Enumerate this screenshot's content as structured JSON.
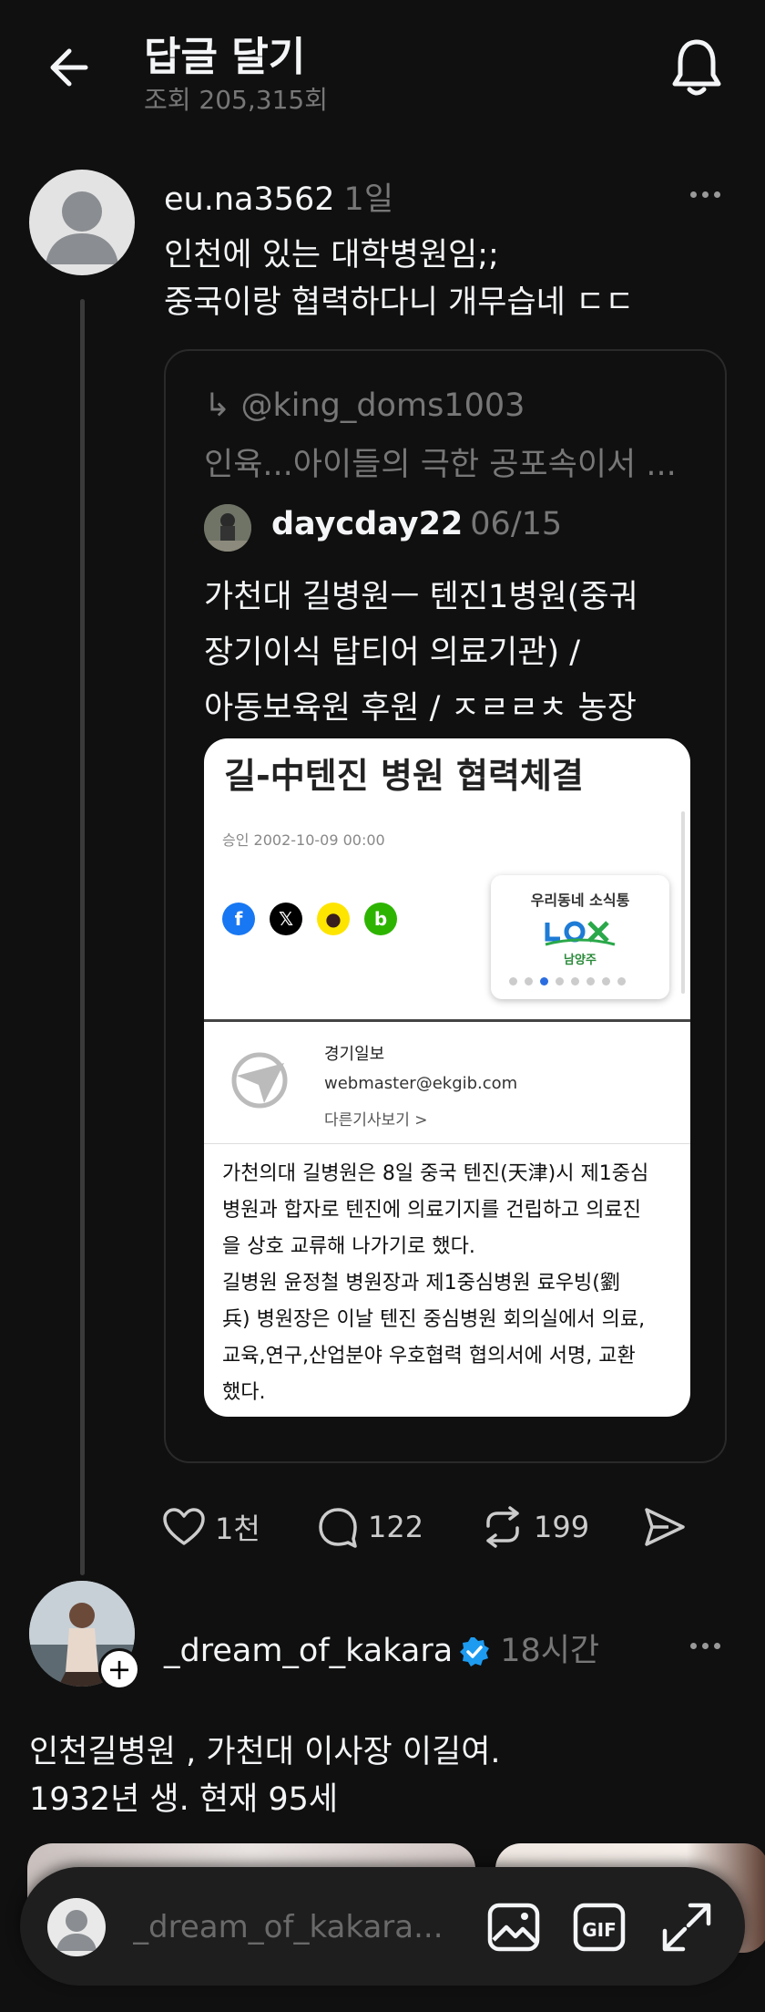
{
  "header": {
    "title": "답글 달기",
    "views": "조회 205,315회"
  },
  "post1": {
    "username": "eu.na3562",
    "time": "1일",
    "text_line1": "인천에 있는 대학병원임;;",
    "text_line2": "중국이랑 협력하다니 개무습네 ㄷㄷ",
    "quote": {
      "reply_to": "@king_doms1003",
      "reply_snippet": "인육...아이들의 극한 공포속이서 ...",
      "username": "daycday22",
      "date": "06/15",
      "text_line1": "가천대 길병원ㅡ 텐진1병원(중궈",
      "text_line2": "장기이식 탑티어  의료기관) /",
      "text_line3": "아동보육원 후원 /  ㅈㄹㄹㅊ 농장",
      "article": {
        "title": "길-中텐진 병원 협력체결",
        "date": "승인 2002-10-09 00:00",
        "widget_title": "우리동네 소식통",
        "widget_sub": "남양주",
        "press_name": "경기일보",
        "press_email": "webmaster@ekgib.com",
        "press_more": "다른기사보기 >",
        "body_line1": "가천의대 길병원은 8일 중국 텐진(天津)시 제1중심",
        "body_line2": "병원과 합자로 텐진에 의료기지를 건립하고 의료진",
        "body_line3": "을 상호 교류해 나가기로 했다.",
        "body_line4": "길병원 윤정철 병원장과 제1중심병원 료우빙(劉",
        "body_line5": "兵) 병원장은 이날 텐진 중심병원 회의실에서 의료,",
        "body_line6": "교육,연구,산업분야 우호협력 협의서에 서명, 교환",
        "body_line7": "했다."
      }
    },
    "actions": {
      "likes": "1천",
      "comments": "122",
      "reposts": "199"
    }
  },
  "post2": {
    "username": "_dream_of_kakara",
    "time": "18시간",
    "text_line1": "인천길병원 , 가천대 이사장 이길여.",
    "text_line2": "1932년 생. 현재 95세"
  },
  "reply_bar": {
    "placeholder": "_dream_of_kakara..."
  },
  "colors": {
    "background": "#101010",
    "verified_blue": "#1d9bf0",
    "muted_text": "#777777"
  },
  "icons": [
    "back-arrow-icon",
    "bell-icon",
    "more-icon",
    "heart-icon",
    "comment-icon",
    "repost-icon",
    "share-icon",
    "verified-icon",
    "plus-icon",
    "image-icon",
    "gif-icon",
    "expand-icon"
  ]
}
